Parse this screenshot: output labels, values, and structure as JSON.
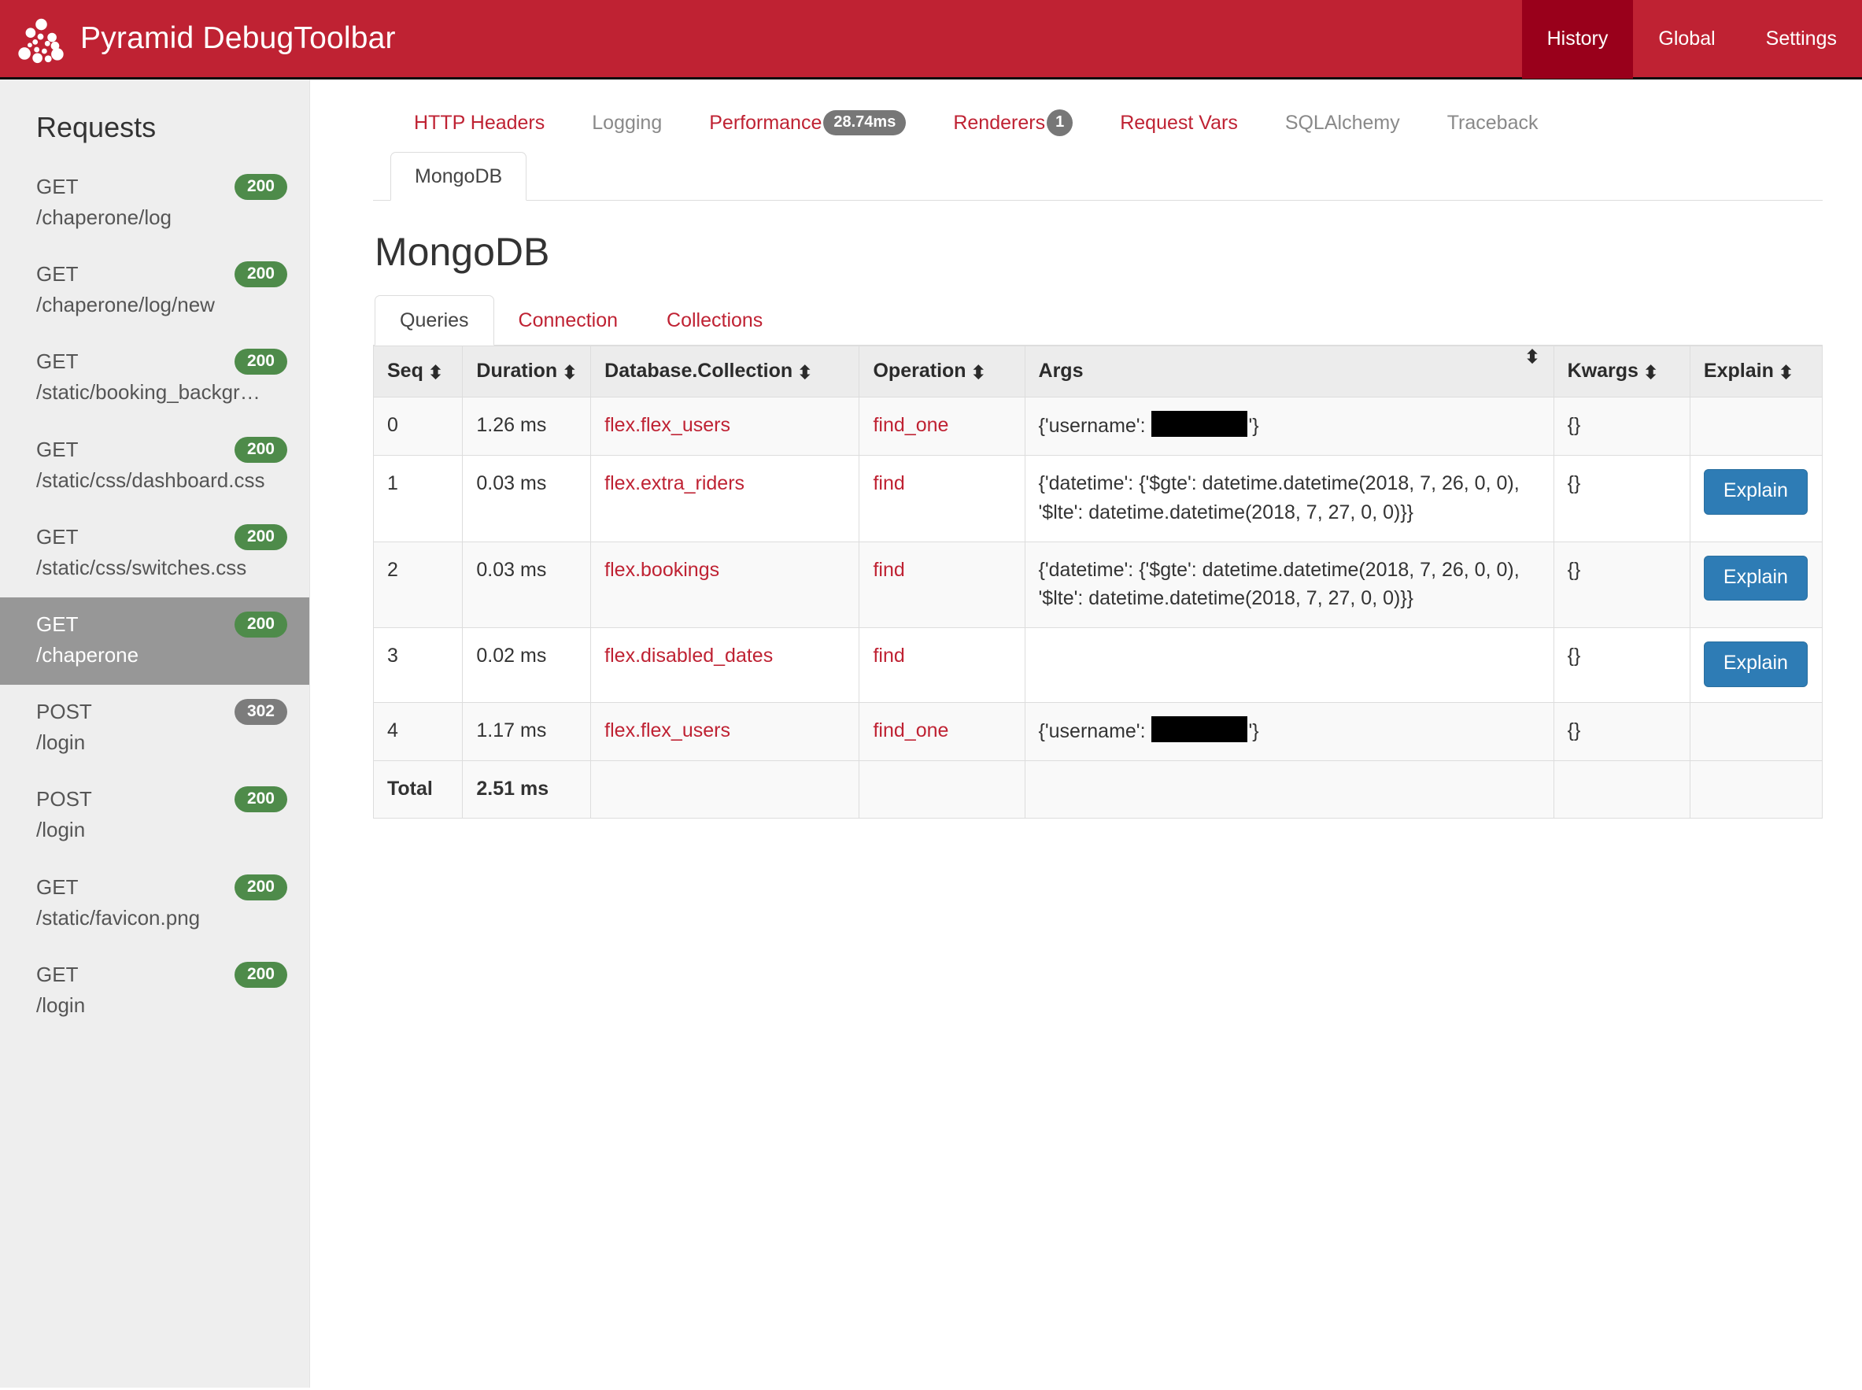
{
  "header": {
    "brand_title": "Pyramid DebugToolbar",
    "logo_icon": "pyramid-dots-logo-icon",
    "nav": [
      {
        "label": "History",
        "active": true
      },
      {
        "label": "Global",
        "active": false
      },
      {
        "label": "Settings",
        "active": false
      }
    ]
  },
  "sidebar": {
    "title": "Requests",
    "items": [
      {
        "method": "GET",
        "path": "/chaperone/log",
        "status": "200",
        "status_kind": "success",
        "selected": false
      },
      {
        "method": "GET",
        "path": "/chaperone/log/new",
        "status": "200",
        "status_kind": "success",
        "selected": false
      },
      {
        "method": "GET",
        "path": "/static/booking_backgr…",
        "status": "200",
        "status_kind": "success",
        "selected": false
      },
      {
        "method": "GET",
        "path": "/static/css/dashboard.css",
        "status": "200",
        "status_kind": "success",
        "selected": false
      },
      {
        "method": "GET",
        "path": "/static/css/switches.css",
        "status": "200",
        "status_kind": "success",
        "selected": false
      },
      {
        "method": "GET",
        "path": "/chaperone",
        "status": "200",
        "status_kind": "success",
        "selected": true
      },
      {
        "method": "POST",
        "path": "/login",
        "status": "302",
        "status_kind": "warning",
        "selected": false
      },
      {
        "method": "POST",
        "path": "/login",
        "status": "200",
        "status_kind": "success",
        "selected": false
      },
      {
        "method": "GET",
        "path": "/static/favicon.png",
        "status": "200",
        "status_kind": "success",
        "selected": false
      },
      {
        "method": "GET",
        "path": "/login",
        "status": "200",
        "status_kind": "success",
        "selected": false
      }
    ]
  },
  "toolbar_tabs": [
    {
      "label": "HTTP Headers",
      "badge": "",
      "badge_shape": "",
      "enabled": true
    },
    {
      "label": "Logging",
      "badge": "",
      "badge_shape": "",
      "enabled": false
    },
    {
      "label": "Performance",
      "badge": "28.74ms",
      "badge_shape": "pill",
      "enabled": true
    },
    {
      "label": "Renderers",
      "badge": "1",
      "badge_shape": "round",
      "enabled": true
    },
    {
      "label": "Request Vars",
      "badge": "",
      "badge_shape": "",
      "enabled": true
    },
    {
      "label": "SQLAlchemy",
      "badge": "",
      "badge_shape": "",
      "enabled": false
    },
    {
      "label": "Traceback",
      "badge": "",
      "badge_shape": "",
      "enabled": false
    }
  ],
  "active_subtab": {
    "label": "MongoDB"
  },
  "panel": {
    "title": "MongoDB",
    "inner_tabs": [
      {
        "label": "Queries",
        "active": true
      },
      {
        "label": "Connection",
        "active": false
      },
      {
        "label": "Collections",
        "active": false
      }
    ],
    "table": {
      "columns": [
        {
          "label": "Seq",
          "sortable": true
        },
        {
          "label": "Duration",
          "sortable": true
        },
        {
          "label": "Database.Collection",
          "sortable": true
        },
        {
          "label": "Operation",
          "sortable": true
        },
        {
          "label": "Args",
          "sortable": true
        },
        {
          "label": "Kwargs",
          "sortable": true
        },
        {
          "label": "Explain",
          "sortable": true
        }
      ],
      "rows": [
        {
          "seq": "0",
          "duration": "1.26 ms",
          "collection": "flex.flex_users",
          "operation": "find_one",
          "args_prefix": "{'username': ",
          "args_redacted": true,
          "args_suffix": "'}",
          "kwargs": "{}",
          "explain": ""
        },
        {
          "seq": "1",
          "duration": "0.03 ms",
          "collection": "flex.extra_riders",
          "operation": "find",
          "args_prefix": "{'datetime': {'$gte': datetime.datetime(2018, 7, 26, 0, 0), '$lte': datetime.datetime(2018, 7, 27, 0, 0)}}",
          "args_redacted": false,
          "args_suffix": "",
          "kwargs": "{}",
          "explain": "Explain"
        },
        {
          "seq": "2",
          "duration": "0.03 ms",
          "collection": "flex.bookings",
          "operation": "find",
          "args_prefix": "{'datetime': {'$gte': datetime.datetime(2018, 7, 26, 0, 0), '$lte': datetime.datetime(2018, 7, 27, 0, 0)}}",
          "args_redacted": false,
          "args_suffix": "",
          "kwargs": "{}",
          "explain": "Explain"
        },
        {
          "seq": "3",
          "duration": "0.02 ms",
          "collection": "flex.disabled_dates",
          "operation": "find",
          "args_prefix": "",
          "args_redacted": false,
          "args_suffix": "",
          "kwargs": "{}",
          "explain": "Explain"
        },
        {
          "seq": "4",
          "duration": "1.17 ms",
          "collection": "flex.flex_users",
          "operation": "find_one",
          "args_prefix": "{'username': ",
          "args_redacted": true,
          "args_suffix": "'}",
          "kwargs": "{}",
          "explain": ""
        }
      ],
      "total": {
        "label": "Total",
        "duration": "2.51 ms"
      }
    }
  },
  "colors": {
    "brand_red": "#bf2233",
    "brand_red_active": "#99001b",
    "link_red": "#bf2233",
    "badge_success": "#4e8b4a",
    "badge_warning": "#7c7c7c",
    "explain_blue": "#2e7cb5",
    "sidebar_bg": "#eeeeee",
    "sidebar_selected": "#979797"
  }
}
